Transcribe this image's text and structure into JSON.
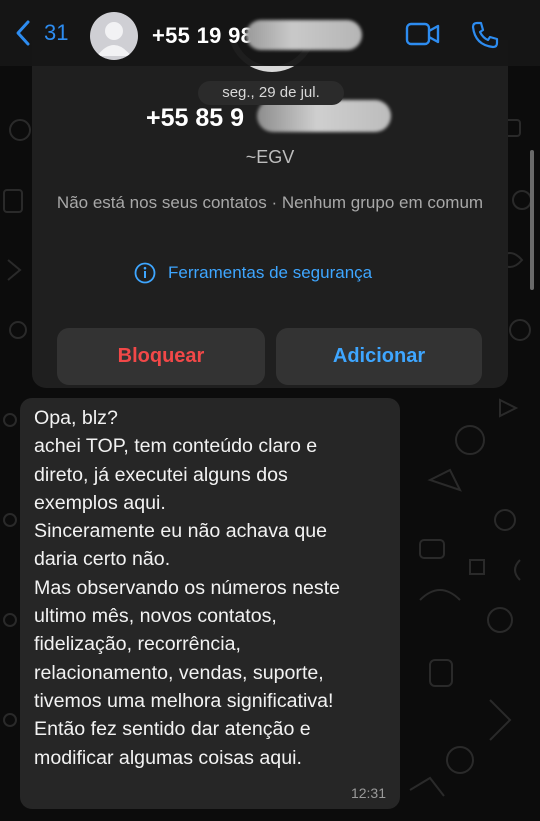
{
  "header": {
    "back_count": "31",
    "phone_prefix": "+55 19 98"
  },
  "card": {
    "date": "seg., 29 de jul.",
    "phone_prefix": "+55 85 9",
    "name": "~EGV",
    "subtitle": "Não está nos seus contatos · Nenhum grupo em comum",
    "security_label": "Ferramentas de segurança",
    "block_label": "Bloquear",
    "add_label": "Adicionar"
  },
  "message": {
    "lines": [
      "Opa, blz?",
      "achei TOP, tem conteúdo claro e",
      "direto, já executei alguns dos",
      "exemplos aqui.",
      "Sinceramente eu não achava que",
      "daria certo não.",
      "Mas observando os números neste",
      "ultimo mês, novos contatos,",
      "fidelização, recorrência,",
      "relacionamento, vendas, suporte,",
      "tivemos uma melhora significativa!",
      "Então fez sentido dar atenção e",
      "modificar algumas coisas aqui."
    ],
    "time": "12:31"
  },
  "colors": {
    "accent": "#3ea6ff",
    "danger": "#f24848",
    "bubble": "#262626",
    "card": "#1f1f1f"
  },
  "icons": [
    "chevron-left-icon",
    "avatar-icon",
    "video-call-icon",
    "phone-call-icon",
    "info-icon"
  ]
}
